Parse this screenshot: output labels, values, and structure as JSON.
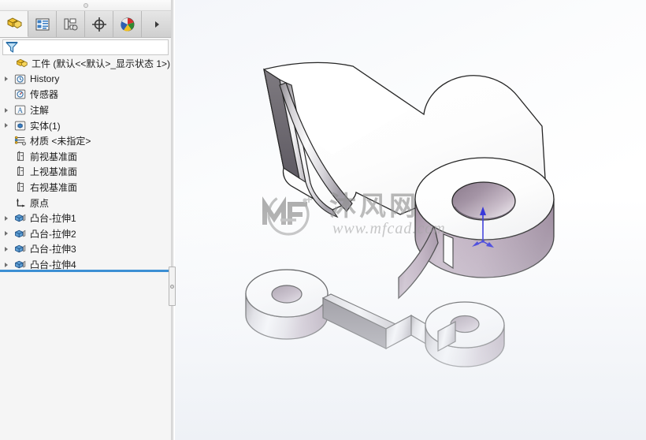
{
  "window": {
    "app": "SolidWorks",
    "splitter_handle": "panel-splitter"
  },
  "tabs": [
    {
      "id": "feature-manager",
      "icon": "yellow-part-icon",
      "label": "FeatureManager 设计树",
      "active": true
    },
    {
      "id": "property-manager",
      "icon": "property-manager-icon",
      "label": "PropertyManager",
      "active": false
    },
    {
      "id": "configuration-manager",
      "icon": "configuration-manager-icon",
      "label": "ConfigurationManager",
      "active": false
    },
    {
      "id": "dimxpert-manager",
      "icon": "dimxpert-crosshair-icon",
      "label": "DimXpertManager",
      "active": false
    },
    {
      "id": "display-manager",
      "icon": "color-wheel-icon",
      "label": "DisplayManager",
      "active": false
    }
  ],
  "tab_overflow_label": "›",
  "filter": {
    "icon": "funnel-filter-icon",
    "value": "",
    "placeholder": ""
  },
  "tree": {
    "root": {
      "icon": "yellow-part-icon",
      "label": "工件  (默认<<默认>_显示状态 1>)"
    },
    "items": [
      {
        "label": "History",
        "icon": "history-folder-icon",
        "expandable": true
      },
      {
        "label": "传感器",
        "icon": "sensor-folder-icon",
        "expandable": false
      },
      {
        "label": "注解",
        "icon": "annotations-folder-icon",
        "expandable": true
      },
      {
        "label": "实体(1)",
        "icon": "solid-bodies-folder-icon",
        "expandable": true
      },
      {
        "label": "材质 <未指定>",
        "icon": "material-icon",
        "expandable": false
      },
      {
        "label": "前视基准面",
        "icon": "plane-icon",
        "expandable": false
      },
      {
        "label": "上视基准面",
        "icon": "plane-icon",
        "expandable": false
      },
      {
        "label": "右视基准面",
        "icon": "plane-icon",
        "expandable": false
      },
      {
        "label": "原点",
        "icon": "origin-icon",
        "expandable": false
      },
      {
        "label": "凸台-拉伸1",
        "icon": "boss-extrude-icon",
        "expandable": true
      },
      {
        "label": "凸台-拉伸2",
        "icon": "boss-extrude-icon",
        "expandable": true
      },
      {
        "label": "凸台-拉伸3",
        "icon": "boss-extrude-icon",
        "expandable": true
      },
      {
        "label": "凸台-拉伸4",
        "icon": "boss-extrude-icon",
        "expandable": true
      }
    ],
    "rollback_bar": "rollback-bar"
  },
  "graphics": {
    "model_name": "工件",
    "triad": {
      "icon": "origin-triad-icon",
      "color": "#2c2cd8"
    },
    "colors": {
      "background_top": "#f4f6fa",
      "background_bottom": "#eef1f6",
      "face_top": "#ffffff",
      "face_side_light": "#e9e9e9",
      "face_side_dark": "#6e6a72",
      "bore_mauve": "#b6a3b6",
      "edge": "#1e1e1e"
    }
  },
  "watermark": {
    "logo": "mf-logo-icon",
    "brand": "沐风网",
    "url": "www.mfcad.com"
  }
}
